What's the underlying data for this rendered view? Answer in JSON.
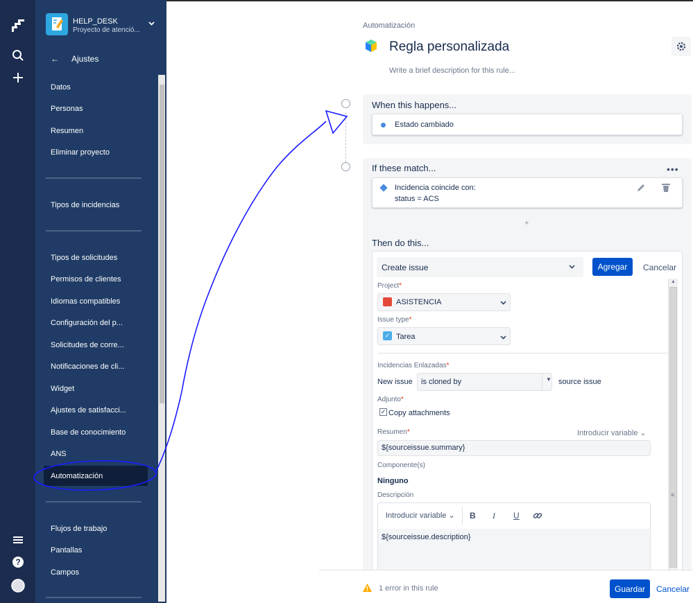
{
  "sidebar": {
    "project_name": "HELP_DESK",
    "project_subtitle": "Proyecto de atenció...",
    "back_label": "Ajustes",
    "group1": [
      "Datos",
      "Personas",
      "Resumen",
      "Eliminar proyecto"
    ],
    "group2": [
      "Tipos de incidencias"
    ],
    "group3": [
      "Tipos de solicitudes",
      "Permisos de clientes",
      "Idiomas compatibles",
      "Configuración del p...",
      "Solicitudes de corre...",
      "Notificaciones de cli...",
      "Widget",
      "Ajustes de satisfacci...",
      "Base de conocimiento",
      "ANS",
      "Automatización"
    ],
    "group4": [
      "Flujos de trabajo",
      "Pantallas",
      "Campos"
    ],
    "active_item": "Automatización"
  },
  "rail": {
    "icons": [
      "jira-logo-icon",
      "search-icon",
      "plus-icon",
      "menu-icon",
      "help-icon",
      "avatar-icon"
    ]
  },
  "header": {
    "breadcrumb": "Automatización",
    "title": "Regla personalizada",
    "description_placeholder": "Write a brief description for this rule..."
  },
  "trigger": {
    "heading": "When this happens...",
    "item": "Estado cambiado"
  },
  "condition": {
    "heading": "If these match...",
    "line1": "Incidencia coincide con:",
    "line2": "status = ACS"
  },
  "action": {
    "heading": "Then do this...",
    "action_select": "Create issue",
    "add_button": "Agregar",
    "cancel_button": "Cancelar",
    "project_label": "Project",
    "project_value": "ASISTENCIA",
    "issue_type_label": "Issue type",
    "issue_type_value": "Tarea",
    "linked_label": "Incidencias Enlazadas",
    "new_issue": "New issue",
    "link_type": "is cloned by",
    "source_issue": "source issue",
    "attachment_label": "Adjunto",
    "copy_attachments": "Copy attachments",
    "summary_label": "Resumen",
    "insert_variable": "Introducir variable",
    "summary_value": "${sourceissue.summary}",
    "components_label": "Componente(s)",
    "components_value": "Ninguno",
    "description_label": "Descripción",
    "editor_insert_variable": "Introducir variable",
    "bold": "B",
    "italic": "I",
    "underline": "U",
    "description_value": "${sourceissue.description}"
  },
  "footer": {
    "error_text": "1 error in this rule",
    "save_button": "Guardar",
    "cancel_button": "Cancelar"
  },
  "colors": {
    "sidebar": "#203c66",
    "rail": "#1b2c4f",
    "primary": "#0052cc",
    "annotation": "#1a1aff"
  }
}
